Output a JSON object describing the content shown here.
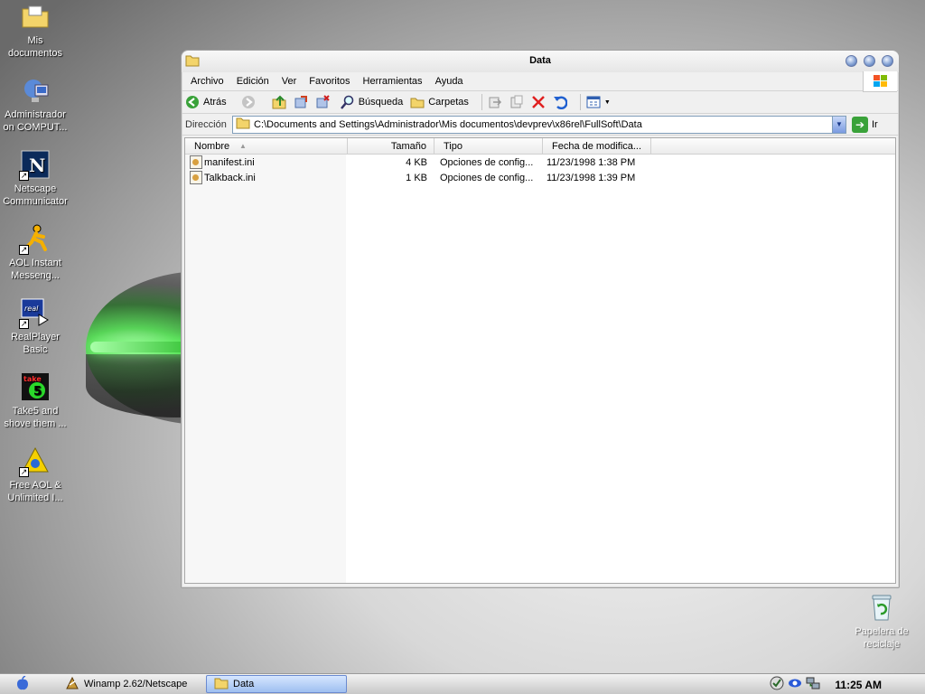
{
  "desktop": {
    "icons": [
      {
        "label": "Mis documentos",
        "icon": "documents-folder-icon"
      },
      {
        "label": "Administrador on COMPUT...",
        "icon": "network-computer-icon"
      },
      {
        "label": "Netscape Communicator",
        "icon": "netscape-icon"
      },
      {
        "label": "AOL Instant Messeng...",
        "icon": "aim-running-man-icon"
      },
      {
        "label": "RealPlayer Basic",
        "icon": "realplayer-icon"
      },
      {
        "label": "Take5 and shove them ...",
        "icon": "take5-icon"
      },
      {
        "label": "Free AOL & Unlimited I...",
        "icon": "aol-triangle-icon"
      }
    ],
    "recycle_bin": {
      "label": "Papelera de reciclaje",
      "icon": "recycle-bin-icon"
    }
  },
  "window": {
    "title": "Data",
    "menu": [
      "Archivo",
      "Edición",
      "Ver",
      "Favoritos",
      "Herramientas",
      "Ayuda"
    ],
    "toolbar": {
      "back": "Atrás",
      "search": "Búsqueda",
      "folders": "Carpetas"
    },
    "address": {
      "label": "Dirección",
      "path": "C:\\Documents and Settings\\Administrador\\Mis documentos\\devprev\\x86rel\\FullSoft\\Data",
      "go": "Ir"
    },
    "columns": {
      "name": "Nombre",
      "size": "Tamaño",
      "type": "Tipo",
      "date": "Fecha de modifica..."
    },
    "files": [
      {
        "name": "manifest.ini",
        "size": "4 KB",
        "type": "Opciones de config...",
        "date": "11/23/1998 1:38 PM"
      },
      {
        "name": "Talkback.ini",
        "size": "1 KB",
        "type": "Opciones de config...",
        "date": "11/23/1998 1:39 PM"
      }
    ]
  },
  "taskbar": {
    "tasks": [
      {
        "label": "Winamp 2.62/Netscape",
        "active": false
      },
      {
        "label": "Data",
        "active": true
      }
    ],
    "clock": "11:25 AM"
  }
}
